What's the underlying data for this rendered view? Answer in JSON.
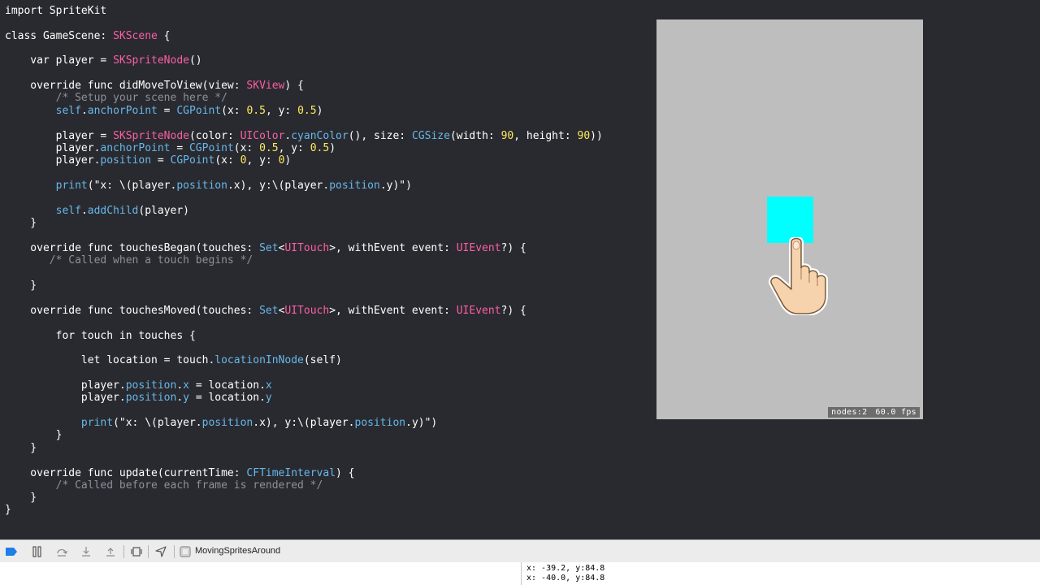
{
  "code": {
    "l1": "import SpriteKit",
    "l2_a": "class GameScene: ",
    "l2_b": "SKScene",
    "l2_c": " {",
    "l3_a": "    var player = ",
    "l3_b": "SKSpriteNode",
    "l3_c": "()",
    "l4_a": "    override func didMoveToView(view: ",
    "l4_b": "SKView",
    "l4_c": ") {",
    "l5": "        /* Setup your scene here */",
    "l6_a": "        ",
    "l6_b": "self",
    "l6_c": ".",
    "l6_d": "anchorPoint",
    "l6_e": " = ",
    "l6_f": "CGPoint",
    "l6_g": "(x: ",
    "l6_h": "0.5",
    "l6_i": ", y: ",
    "l6_j": "0.5",
    "l6_k": ")",
    "l7_a": "        player = ",
    "l7_b": "SKSpriteNode",
    "l7_c": "(color: ",
    "l7_d": "UIColor",
    "l7_e": ".",
    "l7_f": "cyanColor",
    "l7_g": "(), size: ",
    "l7_h": "CGSize",
    "l7_i": "(width: ",
    "l7_j": "90",
    "l7_k": ", height: ",
    "l7_l": "90",
    "l7_m": "))",
    "l8_a": "        player.",
    "l8_b": "anchorPoint",
    "l8_c": " = ",
    "l8_d": "CGPoint",
    "l8_e": "(x: ",
    "l8_f": "0.5",
    "l8_g": ", y: ",
    "l8_h": "0.5",
    "l8_i": ")",
    "l9_a": "        player.",
    "l9_b": "position",
    "l9_c": " = ",
    "l9_d": "CGPoint",
    "l9_e": "(x: ",
    "l9_f": "0",
    "l9_g": ", y: ",
    "l9_h": "0",
    "l9_i": ")",
    "l10_a": "        ",
    "l10_b": "print",
    "l10_c": "(\"x: \\(player.",
    "l10_d": "position",
    "l10_e": ".x), y:\\(player.",
    "l10_f": "position",
    "l10_g": ".y)\")",
    "l11_a": "        ",
    "l11_b": "self",
    "l11_c": ".",
    "l11_d": "addChild",
    "l11_e": "(player)",
    "l12": "    }",
    "l13_a": "    override func touchesBegan(touches: ",
    "l13_b": "Set",
    "l13_c": "<",
    "l13_d": "UITouch",
    "l13_e": ">, withEvent event: ",
    "l13_f": "UIEvent",
    "l13_g": "?) {",
    "l14": "       /* Called when a touch begins */",
    "l15": "    }",
    "l16_a": "    override func touchesMoved(touches: ",
    "l16_b": "Set",
    "l16_c": "<",
    "l16_d": "UITouch",
    "l16_e": ">, withEvent event: ",
    "l16_f": "UIEvent",
    "l16_g": "?) {",
    "l17_a": "        for touch ",
    "l17_b": "in",
    "l17_c": " touches {",
    "l18_a": "            let location = touch.",
    "l18_b": "locationInNode",
    "l18_c": "(self)",
    "l19_a": "            player.",
    "l19_b": "position",
    "l19_c": ".",
    "l19_d": "x",
    "l19_e": " = location.",
    "l19_f": "x",
    "l20_a": "            player.",
    "l20_b": "position",
    "l20_c": ".",
    "l20_d": "y",
    "l20_e": " = location.",
    "l20_f": "y",
    "l21_a": "            ",
    "l21_b": "print",
    "l21_c": "(\"x: \\(player.",
    "l21_d": "position",
    "l21_e": ".x), y:\\(player.",
    "l21_f": "position",
    "l21_g": ".y)\")",
    "l22": "        }",
    "l23": "    }",
    "l24_a": "    override func update(currentTime: ",
    "l24_b": "CFTimeInterval",
    "l24_c": ") {",
    "l25": "        /* Called before each frame is rendered */",
    "l26": "    }",
    "l27": "}"
  },
  "simulator": {
    "nodes_label": "nodes:2",
    "fps_label": "60.0 fps",
    "sprite_color": "#00ffff",
    "background_color": "#bebebe"
  },
  "debug_bar": {
    "target_label": "MovingSpritesAround",
    "icons": [
      "breakpoint-icon",
      "pause-icon",
      "step-over-icon",
      "step-into-icon",
      "step-out-icon",
      "view-debugger-icon",
      "location-icon",
      "target-icon"
    ]
  },
  "console": {
    "lines": [
      "x: -39.2, y:84.8",
      "x: -40.0, y:84.8"
    ]
  },
  "colors": {
    "keyword": "#ffffff",
    "type": "#fc5fa3",
    "system": "#67b7e8",
    "number": "#ffe95b",
    "comment": "#8a9199",
    "editor_bg": "#292a30"
  }
}
